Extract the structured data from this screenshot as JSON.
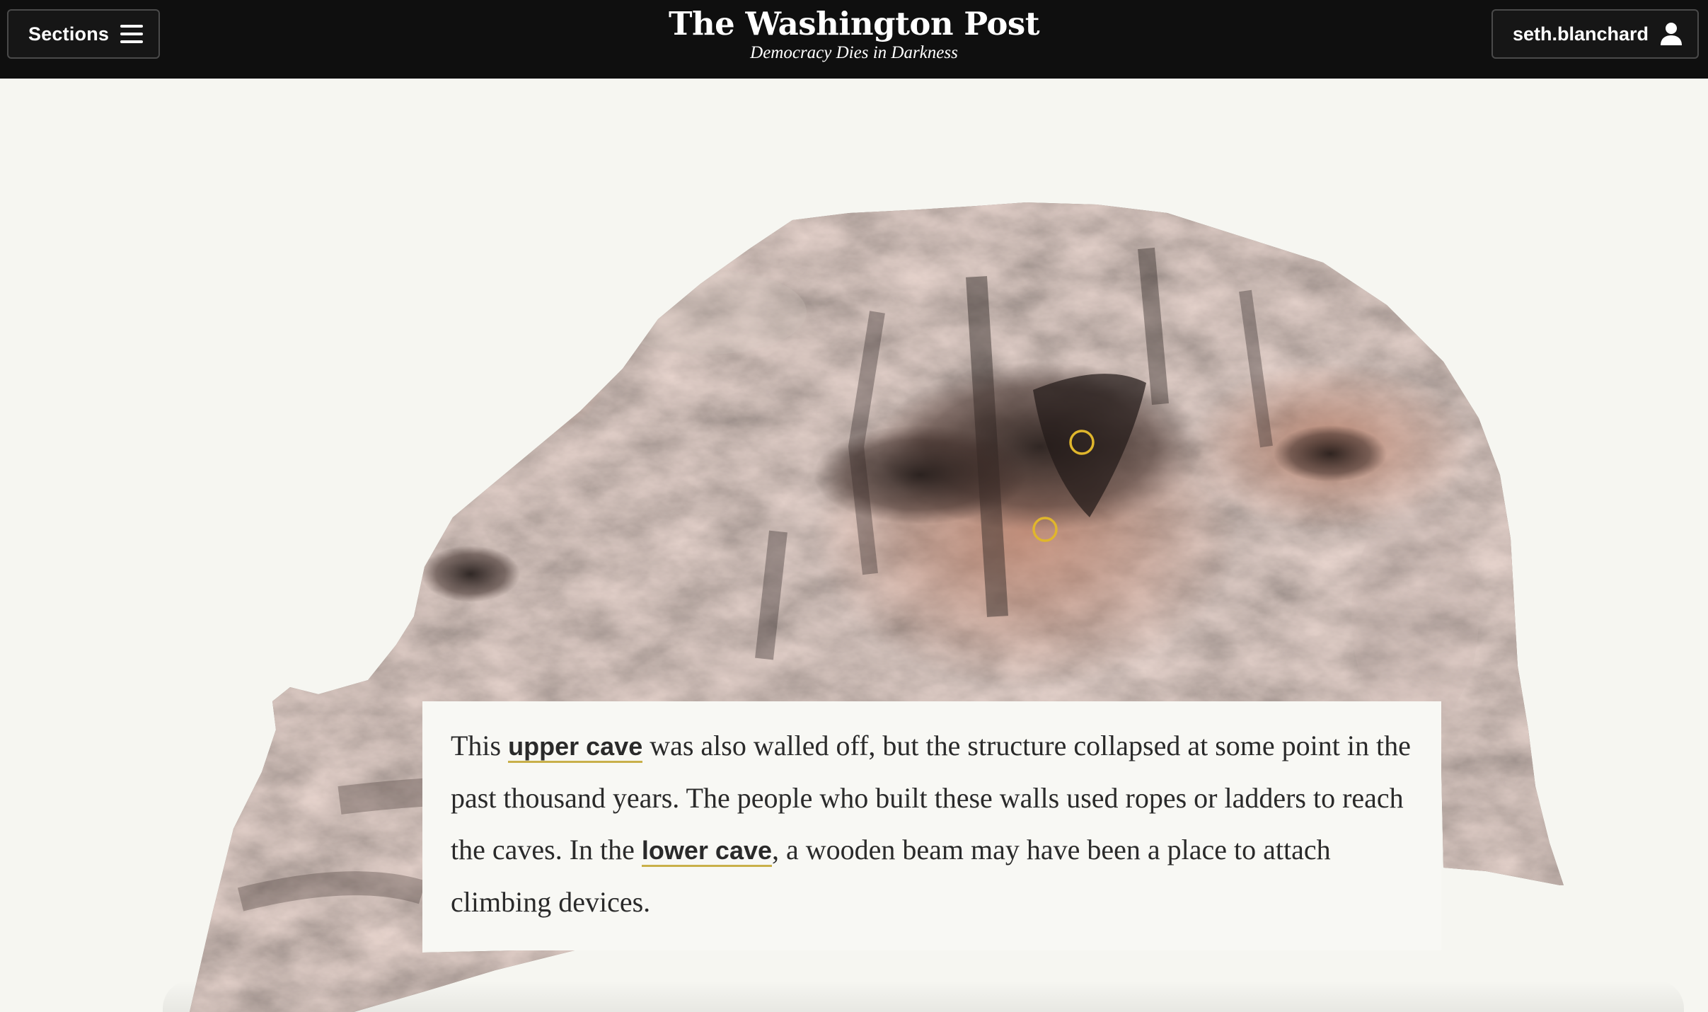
{
  "header": {
    "sections_label": "Sections",
    "logo": "The Washington Post",
    "tagline": "Democracy Dies in Darkness",
    "account_name": "seth.blanchard"
  },
  "caption": {
    "part1": "This ",
    "link1": "upper cave",
    "part2": " was also walled off, but the structure collapsed at some point in the past thousand years. The people who built these walls used ropes or ladders to reach the caves. In the ",
    "link2": "lower cave",
    "part3": ", a wooden beam may have been a place to attach climbing devices."
  },
  "hotspots": [
    {
      "name": "upper-cave-marker"
    },
    {
      "name": "lower-cave-marker"
    }
  ],
  "colors": {
    "header_bg": "#0f0f0f",
    "page_bg": "#f6f6f1",
    "rock_base": "#8a7a72",
    "marker": "#e0b62c",
    "link_underline": "#c9b049"
  },
  "icons": {
    "menu": "hamburger-icon",
    "account": "user-icon"
  }
}
